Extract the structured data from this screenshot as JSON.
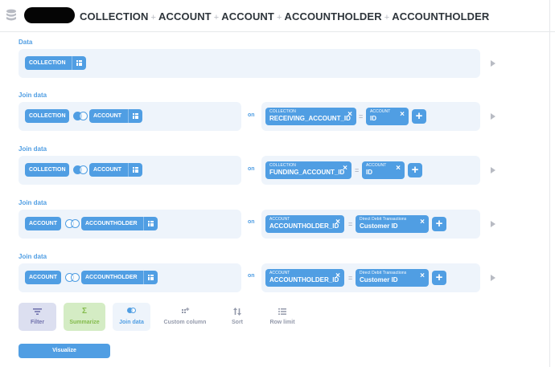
{
  "header": {
    "crumbs": [
      "COLLECTION",
      "ACCOUNT",
      "ACCOUNT",
      "ACCOUNTHOLDER",
      "ACCOUNTHOLDER"
    ],
    "separator": "+"
  },
  "data_step": {
    "label": "Data",
    "table": "COLLECTION"
  },
  "joins": [
    {
      "label": "Join data",
      "left_table": "COLLECTION",
      "right_table": "ACCOUNT",
      "on_label": "on",
      "left_field": {
        "table": "COLLECTION",
        "column": "RECEIVING_ACCOUNT_ID"
      },
      "operator": "=",
      "right_field": {
        "table": "ACCOUNT",
        "column": "ID"
      }
    },
    {
      "label": "Join data",
      "left_table": "COLLECTION",
      "right_table": "ACCOUNT",
      "on_label": "on",
      "left_field": {
        "table": "COLLECTION",
        "column": "FUNDING_ACCOUNT_ID"
      },
      "operator": "=",
      "right_field": {
        "table": "ACCOUNT",
        "column": "ID"
      }
    },
    {
      "label": "Join data",
      "left_table": "ACCOUNT",
      "right_table": "ACCOUNTHOLDER",
      "on_label": "on",
      "left_field": {
        "table": "ACCOUNT",
        "column": "ACCOUNTHOLDER_ID"
      },
      "operator": "=",
      "right_field": {
        "table": "Direct Debit Transactions",
        "column": "Customer ID"
      }
    },
    {
      "label": "Join data",
      "left_table": "ACCOUNT",
      "right_table": "ACCOUNTHOLDER",
      "on_label": "on",
      "left_field": {
        "table": "ACCOUNT",
        "column": "ACCOUNTHOLDER_ID"
      },
      "operator": "=",
      "right_field": {
        "table": "Direct Debit Transactions",
        "column": "Customer ID"
      }
    }
  ],
  "actions": {
    "filter": "Filter",
    "summarize": "Summarize",
    "join": "Join data",
    "custom_column": "Custom column",
    "sort": "Sort",
    "row_limit": "Row limit"
  },
  "icons": {
    "summarize_glyph": "Σ"
  },
  "visualize_label": "Visualize",
  "colors": {
    "accent": "#509ee3",
    "panel": "#eef4fb",
    "filter_bg": "#dcdff0",
    "summarize_bg": "#d4ecc4",
    "summarize_fg": "#84bb4c"
  }
}
